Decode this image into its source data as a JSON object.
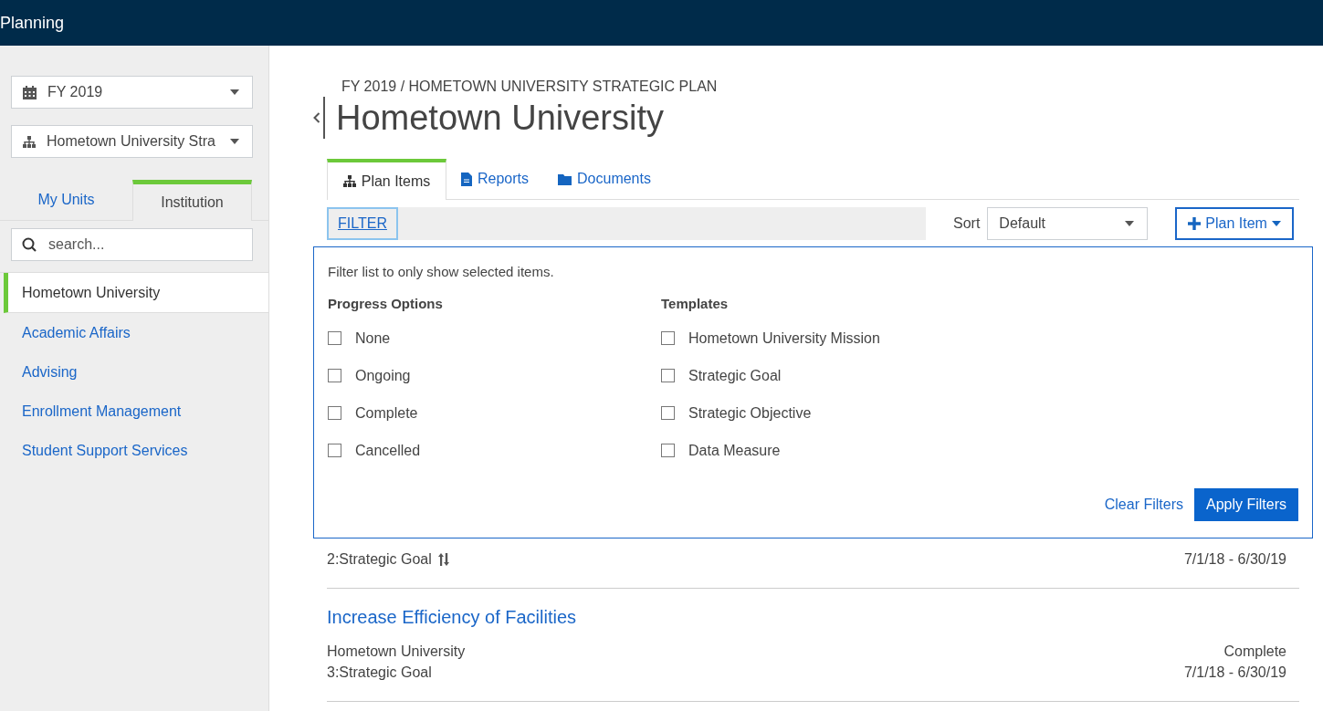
{
  "app_bar": {
    "title": "Planning"
  },
  "sidebar": {
    "year_select": {
      "value": "FY 2019"
    },
    "plan_select": {
      "value": "Hometown University Stra"
    },
    "tabs": [
      {
        "label": "My Units",
        "selected": false
      },
      {
        "label": "Institution",
        "selected": true
      }
    ],
    "search": {
      "placeholder": "search..."
    },
    "items": [
      {
        "label": "Hometown University",
        "selected": true
      },
      {
        "label": "Academic Affairs",
        "selected": false
      },
      {
        "label": "Advising",
        "selected": false
      },
      {
        "label": "Enrollment Management",
        "selected": false
      },
      {
        "label": "Student Support Services",
        "selected": false
      }
    ]
  },
  "main": {
    "breadcrumb": "FY 2019 / HOMETOWN UNIVERSITY STRATEGIC PLAN",
    "title": "Hometown University",
    "tabs": [
      {
        "label": "Plan Items",
        "selected": true
      },
      {
        "label": "Reports",
        "selected": false
      },
      {
        "label": "Documents",
        "selected": false
      }
    ],
    "filter_button": "FILTER",
    "sort_label": "Sort",
    "sort_select": {
      "value": "Default"
    },
    "add_button": "Plan Item",
    "filter_popup": {
      "hint": "Filter list to only show selected items.",
      "groups": [
        {
          "heading": "Progress Options",
          "options": [
            {
              "label": "None",
              "checked": false
            },
            {
              "label": "Ongoing",
              "checked": false
            },
            {
              "label": "Complete",
              "checked": false
            },
            {
              "label": "Cancelled",
              "checked": false
            }
          ]
        },
        {
          "heading": "Templates",
          "options": [
            {
              "label": "Hometown University Mission",
              "checked": false
            },
            {
              "label": "Strategic Goal",
              "checked": false
            },
            {
              "label": "Strategic Objective",
              "checked": false
            },
            {
              "label": "Data Measure",
              "checked": false
            }
          ]
        }
      ],
      "clear_button": "Clear Filters",
      "apply_button": "Apply Filters"
    },
    "items": [
      {
        "type": "2:Strategic Goal",
        "reorder": true,
        "dates": "7/1/18 - 6/30/19"
      },
      {
        "title": "Increase Efficiency of Facilities",
        "unit": "Hometown University",
        "type": "3:Strategic Goal",
        "reorder": false,
        "status": "Complete",
        "dates": "7/1/18 - 6/30/19"
      }
    ]
  }
}
